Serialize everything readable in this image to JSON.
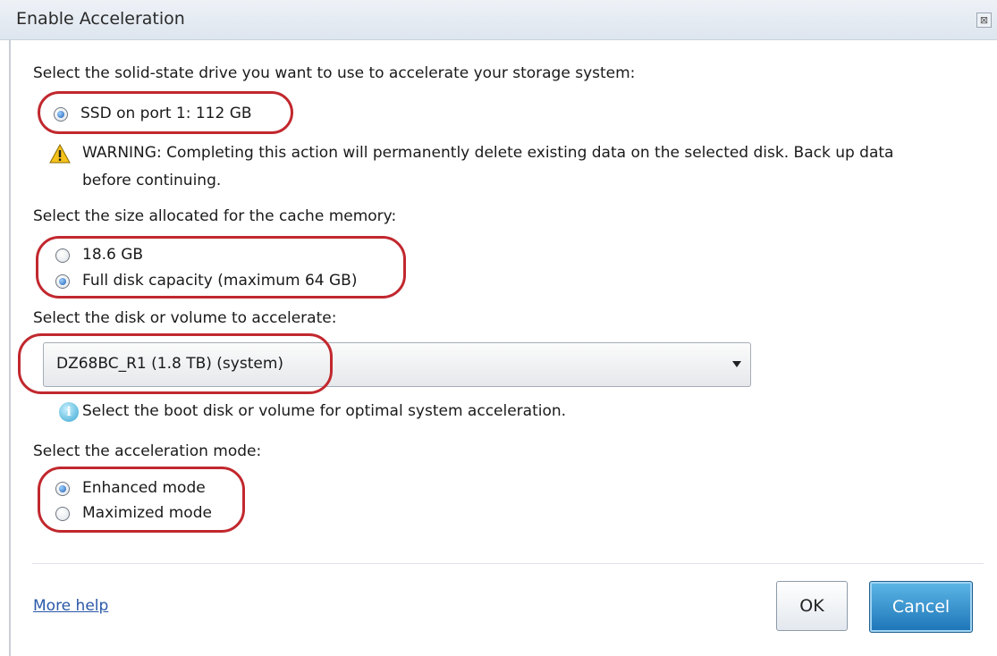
{
  "dialog": {
    "title": "Enable Acceleration",
    "close_label": "⊠"
  },
  "ssd_section": {
    "prompt": "Select the solid-state drive you want to use to accelerate your storage system:",
    "option": "SSD on port 1: 112 GB",
    "option_selected": true,
    "warning_line1": "WARNING: Completing this action will permanently delete existing data on the selected disk. Back up data",
    "warning_line2": "before continuing."
  },
  "cache_section": {
    "prompt": "Select the size allocated for the cache memory:",
    "options": [
      {
        "label": "18.6 GB",
        "selected": false
      },
      {
        "label": "Full disk capacity (maximum 64 GB)",
        "selected": true
      }
    ]
  },
  "volume_section": {
    "prompt": "Select the disk or volume to accelerate:",
    "selected_value": "DZ68BC_R1 (1.8 TB) (system)",
    "info": "Select the boot disk or volume for optimal system acceleration."
  },
  "mode_section": {
    "prompt": "Select the acceleration mode:",
    "options": [
      {
        "label": "Enhanced mode",
        "selected": true
      },
      {
        "label": "Maximized mode",
        "selected": false
      }
    ]
  },
  "footer": {
    "help_link": "More help",
    "ok_label": "OK",
    "cancel_label": "Cancel"
  },
  "colors": {
    "highlight_oval": "#c1282e",
    "cancel_button": "#1d74b8",
    "link": "#2a58a8"
  },
  "icons": {
    "warning": "warning-triangle-icon",
    "info": "info-icon",
    "dropdown": "chevron-down-icon"
  }
}
